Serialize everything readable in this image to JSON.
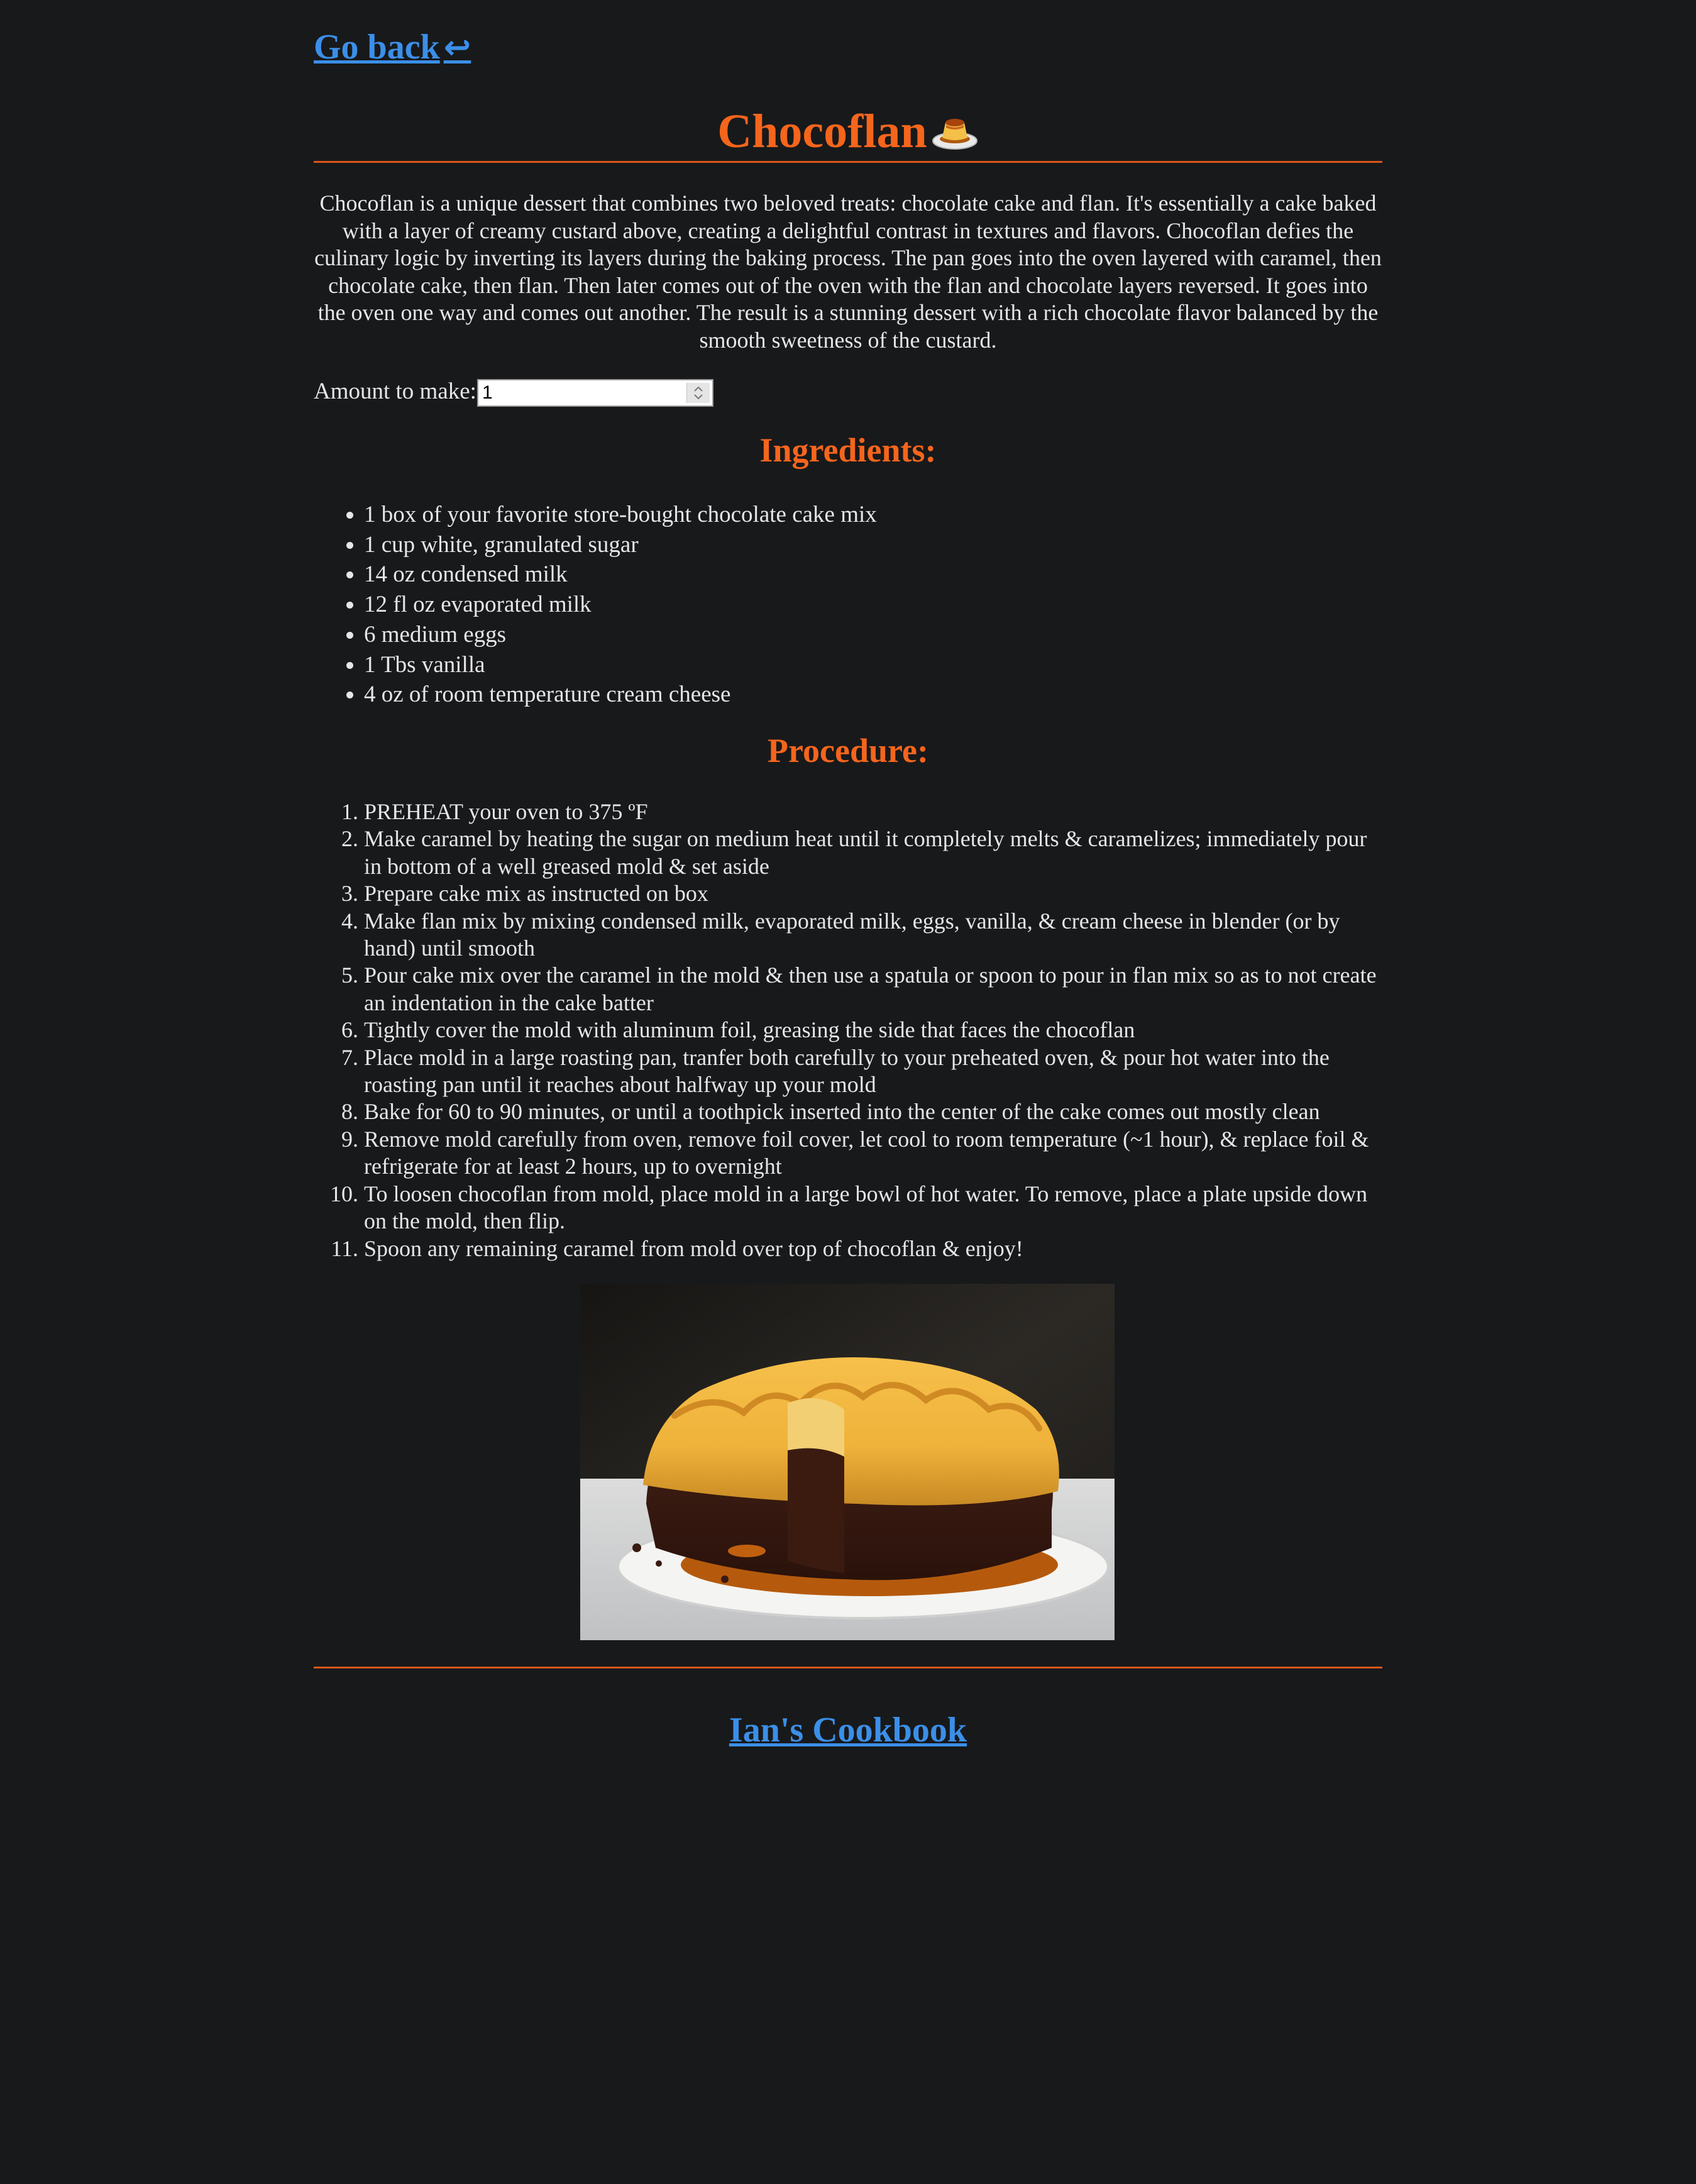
{
  "nav": {
    "back_label": "Go back",
    "back_icon": "return-arrow-icon"
  },
  "recipe": {
    "title": "Chocoflan",
    "title_icon": "flan-icon",
    "description": "Chocoflan is a unique dessert that combines two beloved treats: chocolate cake and flan. It's essentially a cake baked with a layer of creamy custard above, creating a delightful contrast in textures and flavors. Chocoflan defies the culinary logic by inverting its layers during the baking process. The pan goes into the oven layered with caramel, then chocolate cake, then flan. Then later comes out of the oven with the flan and chocolate layers reversed. It goes into the oven one way and comes out another. The result is a stunning dessert with a rich chocolate flavor balanced by the smooth sweetness of the custard.",
    "amount_label": "Amount to make:",
    "amount_value": "1",
    "ingredients_heading": "Ingredients:",
    "ingredients": [
      "1 box of your favorite store-bought chocolate cake mix",
      "1 cup white, granulated sugar",
      "14 oz condensed milk",
      "12 fl oz evaporated milk",
      "6 medium eggs",
      "1 Tbs vanilla",
      "4 oz of room temperature cream cheese"
    ],
    "procedure_heading": "Procedure:",
    "procedure": [
      "PREHEAT your oven to 375 ºF",
      "Make caramel by heating the sugar on medium heat until it completely melts & caramelizes; immediately pour in bottom of a well greased mold & set aside",
      "Prepare cake mix as instructed on box",
      "Make flan mix by mixing condensed milk, evaporated milk, eggs, vanilla, & cream cheese in blender (or by hand) until smooth",
      "Pour cake mix over the caramel in the mold & then use a spatula or spoon to pour in flan mix so as to not create an indentation in the cake batter",
      "Tightly cover the mold with aluminum foil, greasing the side that faces the chocoflan",
      "Place mold in a large roasting pan, tranfer both carefully to your preheated oven, & pour hot water into the roasting pan until it reaches about halfway up your mold",
      "Bake for 60 to 90 minutes, or until a toothpick inserted into the center of the cake comes out mostly clean",
      "Remove mold carefully from oven, remove foil cover, let cool to room temperature (~1 hour), & replace foil & refrigerate for at least 2 hours, up to overnight",
      "To loosen chocoflan from mold, place mold in a large bowl of hot water. To remove, place a plate upside down on the mold, then flip.",
      "Spoon any remaining caramel from mold over top of chocoflan & enjoy!"
    ]
  },
  "footer": {
    "link_label": "Ian's Cookbook"
  },
  "colors": {
    "background": "#18191b",
    "heading": "#f5651c",
    "link": "#3b8fe8",
    "text": "#e6e6e6"
  }
}
